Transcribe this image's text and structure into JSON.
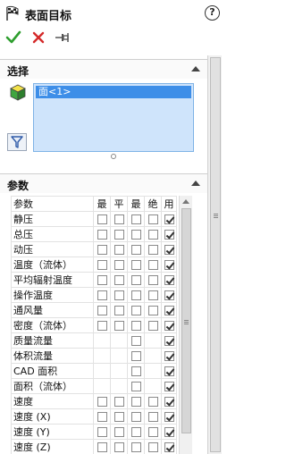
{
  "window": {
    "title": "表面目标",
    "help_label": "?"
  },
  "toolbar": {
    "ok_icon": "checkmark-icon",
    "cancel_icon": "close-icon",
    "pin_icon": "pushpin-icon"
  },
  "selection": {
    "header": "选择",
    "items": [
      "面<1>"
    ]
  },
  "parameters": {
    "header": "参数",
    "columns": [
      "参数",
      "最",
      "平",
      "最",
      "绝",
      "用"
    ],
    "rows": [
      {
        "name": "静压",
        "min": false,
        "avg": false,
        "max": false,
        "bulk": false,
        "use": true
      },
      {
        "name": "总压",
        "min": false,
        "avg": false,
        "max": false,
        "bulk": false,
        "use": true
      },
      {
        "name": "动压",
        "min": false,
        "avg": false,
        "max": false,
        "bulk": false,
        "use": true
      },
      {
        "name": "温度（流体）",
        "min": false,
        "avg": false,
        "max": false,
        "bulk": false,
        "use": true
      },
      {
        "name": "平均辐射温度",
        "min": false,
        "avg": false,
        "max": false,
        "bulk": false,
        "use": true
      },
      {
        "name": "操作温度",
        "min": false,
        "avg": false,
        "max": false,
        "bulk": false,
        "use": true
      },
      {
        "name": "通风量",
        "min": false,
        "avg": false,
        "max": false,
        "bulk": false,
        "use": true
      },
      {
        "name": "密度（流体）",
        "min": false,
        "avg": false,
        "max": false,
        "bulk": false,
        "use": true
      },
      {
        "name": "质量流量",
        "min": null,
        "avg": null,
        "max": false,
        "bulk": null,
        "use": true
      },
      {
        "name": "体积流量",
        "min": null,
        "avg": null,
        "max": false,
        "bulk": null,
        "use": true
      },
      {
        "name": "CAD 面积",
        "min": null,
        "avg": null,
        "max": false,
        "bulk": null,
        "use": true
      },
      {
        "name": "面积（流体）",
        "min": null,
        "avg": null,
        "max": false,
        "bulk": null,
        "use": true
      },
      {
        "name": "速度",
        "min": false,
        "avg": false,
        "max": false,
        "bulk": false,
        "use": true
      },
      {
        "name": "速度 (X)",
        "min": false,
        "avg": false,
        "max": false,
        "bulk": false,
        "use": true
      },
      {
        "name": "速度 (Y)",
        "min": false,
        "avg": false,
        "max": false,
        "bulk": false,
        "use": true
      },
      {
        "name": "速度 (Z)",
        "min": false,
        "avg": false,
        "max": false,
        "bulk": false,
        "use": true
      }
    ]
  }
}
